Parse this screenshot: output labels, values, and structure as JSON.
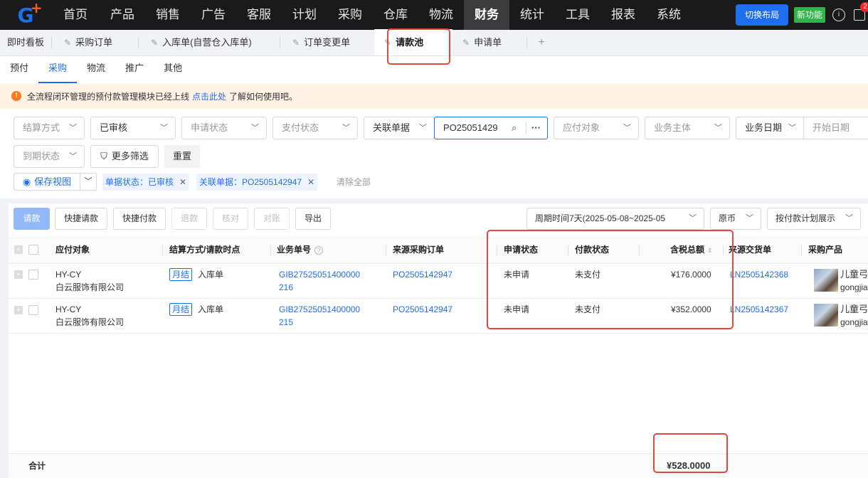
{
  "nav": {
    "items": [
      "首页",
      "产品",
      "销售",
      "广告",
      "客服",
      "计划",
      "采购",
      "仓库",
      "物流",
      "财务",
      "统计",
      "工具",
      "报表",
      "系统"
    ],
    "active": "财务",
    "switch_layout": "切换布局",
    "new_feature": "新功能",
    "badge_count": "2"
  },
  "tabs": {
    "dashboard": "即时看板",
    "items": [
      "采购订单",
      "入库单(自营仓入库单)",
      "订单变更单",
      "请款池",
      "申请单"
    ],
    "active": "请款池",
    "add": "+"
  },
  "subtabs": {
    "items": [
      "预付",
      "采购",
      "物流",
      "推广",
      "其他"
    ],
    "active": "采购"
  },
  "notice": {
    "text_before": "全流程闭环管理的预付款管理模块已经上线",
    "link": "点击此处",
    "text_after": "了解如何使用吧。"
  },
  "filters": {
    "settlement": "结算方式",
    "review": "已审核",
    "apply_status": "申请状态",
    "pay_status": "支付状态",
    "related_doc": "关联单据",
    "search_value": "PO25051429",
    "more_icon": "···",
    "payee": "应付对象",
    "entity": "业务主体",
    "biz_date": "业务日期",
    "start_date": "开始日期",
    "due_status": "到期状态",
    "more_filters": "更多筛选",
    "reset": "重置",
    "save_view": "保存视图",
    "chip_status": "单据状态：已审核",
    "chip_related": "关联单据：PO2505142947",
    "clear_all": "清除全部"
  },
  "actions": {
    "request": "请款",
    "quick_request": "快捷请款",
    "quick_pay": "快捷付款",
    "refund": "退款",
    "verify": "核对",
    "reconcile": "对账",
    "export": "导出",
    "period": "周期时间7天(2025-05-08~2025-05",
    "currency": "原币",
    "display_mode": "按付款计划展示"
  },
  "table": {
    "headers": {
      "payee": "应付对象",
      "settlement": "结算方式/请款时点",
      "biz_no": "业务单号",
      "source_po": "来源采购订单",
      "apply_status": "申请状态",
      "pay_status": "付款状态",
      "total": "含税总额",
      "source_delivery": "来源交货单",
      "product": "采购产品"
    },
    "rows": [
      {
        "payee_code": "HY-CY",
        "payee_name": "白云服饰有限公司",
        "settle_tag": "月结",
        "settle_type": "入库单",
        "biz_no_1": "GIB27525051400000",
        "biz_no_2": "216",
        "source_po": "PO2505142947",
        "apply_status": "未申请",
        "pay_status": "未支付",
        "total": "¥176.0000",
        "delivery": "LN2505142368",
        "product_1": "儿童弓箭",
        "product_2": "gongjian"
      },
      {
        "payee_code": "HY-CY",
        "payee_name": "白云服饰有限公司",
        "settle_tag": "月结",
        "settle_type": "入库单",
        "biz_no_1": "GIB27525051400000",
        "biz_no_2": "215",
        "source_po": "PO2505142947",
        "apply_status": "未申请",
        "pay_status": "未支付",
        "total": "¥352.0000",
        "delivery": "LN2505142367",
        "product_1": "儿童弓箭",
        "product_2": "gongjian"
      }
    ],
    "footer_label": "合计",
    "footer_total": "¥528.0000"
  },
  "colors": {
    "accent": "#1e6ff0",
    "annotation": "#e8453c"
  }
}
